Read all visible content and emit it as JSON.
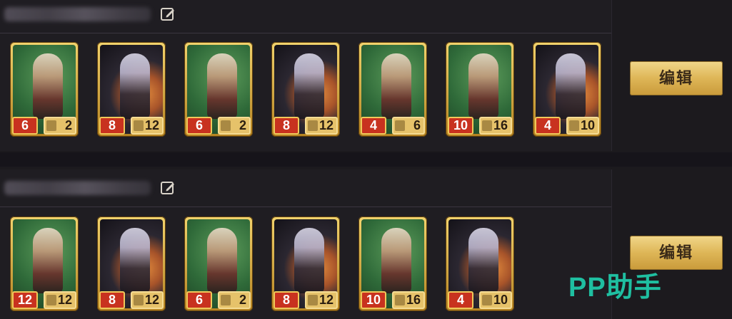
{
  "decks": [
    {
      "cards": [
        {
          "cost": "6",
          "power": "2",
          "art": "green"
        },
        {
          "cost": "8",
          "power": "12",
          "art": "dark"
        },
        {
          "cost": "6",
          "power": "2",
          "art": "green"
        },
        {
          "cost": "8",
          "power": "12",
          "art": "dark"
        },
        {
          "cost": "4",
          "power": "6",
          "art": "green"
        },
        {
          "cost": "10",
          "power": "16",
          "art": "green"
        },
        {
          "cost": "4",
          "power": "10",
          "art": "dark"
        }
      ],
      "edit_label": "编辑"
    },
    {
      "cards": [
        {
          "cost": "12",
          "power": "12",
          "art": "green"
        },
        {
          "cost": "8",
          "power": "12",
          "art": "dark"
        },
        {
          "cost": "6",
          "power": "2",
          "art": "green"
        },
        {
          "cost": "8",
          "power": "12",
          "art": "dark"
        },
        {
          "cost": "10",
          "power": "16",
          "art": "green"
        },
        {
          "cost": "4",
          "power": "10",
          "art": "dark"
        }
      ],
      "edit_label": "编辑"
    }
  ],
  "watermark": "PP助手",
  "icons": {
    "rename": "pencil-square-icon"
  },
  "colors": {
    "accent_gold": "#deb657",
    "cost_red": "#c8321f",
    "watermark_teal": "#1fbfa1"
  }
}
